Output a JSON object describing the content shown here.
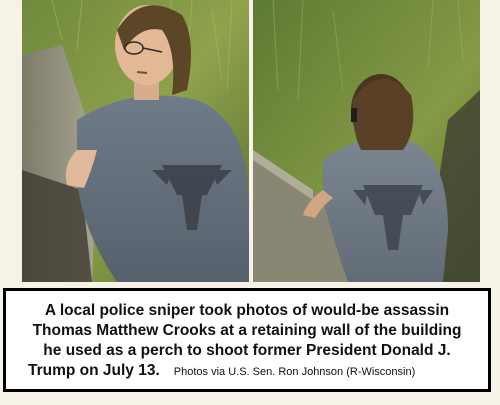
{
  "photos": [
    {
      "description": "left-photo"
    },
    {
      "description": "right-photo"
    }
  ],
  "caption": {
    "line1": "A local police sniper took photos of would-be assassin",
    "line2": "Thomas Matthew Crooks at a retaining wall of the building",
    "line3": "he used as a perch to shoot former President Donald J.",
    "line4": "Trump on July 13.",
    "credit": "Photos via U.S. Sen. Ron Johnson (R-Wisconsin)"
  }
}
